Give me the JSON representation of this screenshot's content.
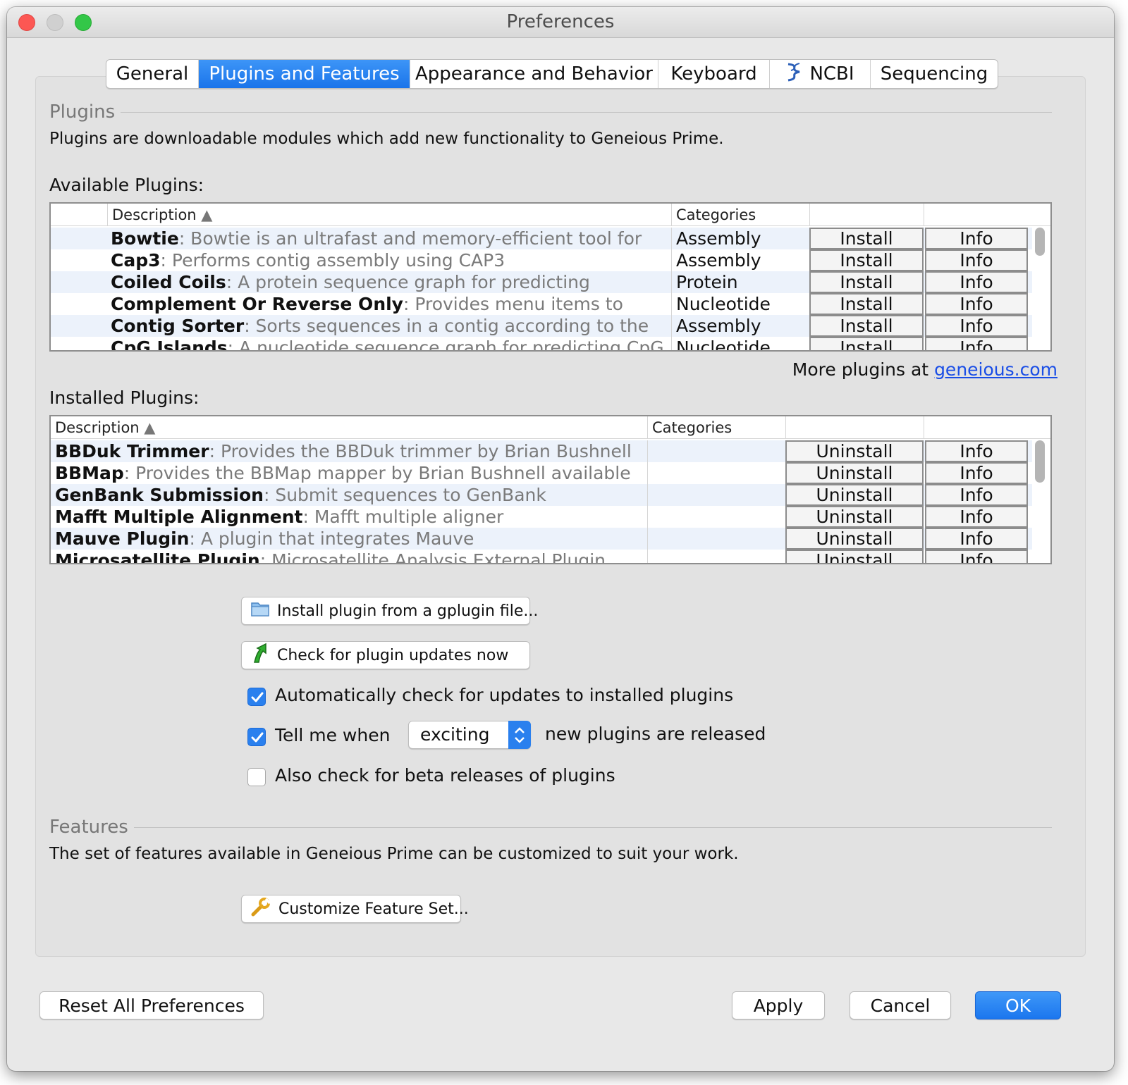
{
  "window": {
    "title": "Preferences"
  },
  "tabs": [
    {
      "label": "General",
      "active": false
    },
    {
      "label": "Plugins and Features",
      "active": true
    },
    {
      "label": "Appearance and Behavior",
      "active": false
    },
    {
      "label": "Keyboard",
      "active": false
    },
    {
      "label": "NCBI",
      "active": false,
      "icon": "ncbi-helix-icon"
    },
    {
      "label": "Sequencing",
      "active": false
    }
  ],
  "plugins": {
    "heading": "Plugins",
    "intro": "Plugins are downloadable modules which add new functionality to Geneious Prime.",
    "available_label": "Available Plugins:",
    "available_columns": [
      "Description",
      "Categories"
    ],
    "available": [
      {
        "name": "Bowtie",
        "desc": ": Bowtie is an ultrafast and memory-efficient tool for",
        "category": "Assembly",
        "action": "Install",
        "info": "Info"
      },
      {
        "name": "Cap3",
        "desc": ": Performs contig assembly using CAP3",
        "category": "Assembly",
        "action": "Install",
        "info": "Info"
      },
      {
        "name": "Coiled Coils",
        "desc": ": A protein sequence graph for predicting",
        "category": "Protein",
        "action": "Install",
        "info": "Info"
      },
      {
        "name": "Complement Or Reverse Only",
        "desc": ": Provides menu items to",
        "category": "Nucleotide",
        "action": "Install",
        "info": "Info"
      },
      {
        "name": "Contig Sorter",
        "desc": ": Sorts sequences in a contig according to the",
        "category": "Assembly",
        "action": "Install",
        "info": "Info"
      },
      {
        "name": "CpG Islands",
        "desc": ": A nucleotide sequence graph for predicting CpG",
        "category": "Nucleotide",
        "action": "Install",
        "info": "Info"
      }
    ],
    "more_text": "More plugins at ",
    "more_link": "geneious.com",
    "installed_label": "Installed Plugins:",
    "installed_columns": [
      "Description",
      "Categories"
    ],
    "installed": [
      {
        "name": "BBDuk Trimmer",
        "desc": ": Provides the BBDuk trimmer by Brian Bushnell",
        "category": "",
        "action": "Uninstall",
        "info": "Info"
      },
      {
        "name": "BBMap",
        "desc": ": Provides the BBMap mapper by Brian Bushnell available",
        "category": "",
        "action": "Uninstall",
        "info": "Info"
      },
      {
        "name": "GenBank Submission",
        "desc": ": Submit sequences to GenBank",
        "category": "",
        "action": "Uninstall",
        "info": "Info"
      },
      {
        "name": "Mafft Multiple Alignment",
        "desc": ": Mafft multiple aligner",
        "category": "",
        "action": "Uninstall",
        "info": "Info"
      },
      {
        "name": "Mauve Plugin",
        "desc": ": A plugin that integrates Mauve",
        "category": "",
        "action": "Uninstall",
        "info": "Info"
      },
      {
        "name": "Microsatellite Plugin",
        "desc": ": Microsatellite Analysis External Plugin",
        "category": "",
        "action": "Uninstall",
        "info": "Info"
      }
    ],
    "install_file_button": "Install plugin from a gplugin file...",
    "check_updates_button": "Check for plugin updates now",
    "auto_check_label": "Automatically check for updates to installed plugins",
    "auto_check": true,
    "tell_me_label": "Tell me when",
    "tell_me": true,
    "tell_me_value": "exciting",
    "tell_me_suffix": "new plugins are released",
    "beta_label": "Also check for beta releases of plugins",
    "beta": false
  },
  "features": {
    "heading": "Features",
    "intro": "The set of features available in Geneious Prime can be customized to suit your work.",
    "customize_button": "Customize Feature Set..."
  },
  "footer": {
    "reset": "Reset All Preferences",
    "apply": "Apply",
    "cancel": "Cancel",
    "ok": "OK"
  },
  "colors": {
    "accent": "#1a74ea",
    "link": "#1a4ee6",
    "row_alt": "#ecf2fb"
  }
}
